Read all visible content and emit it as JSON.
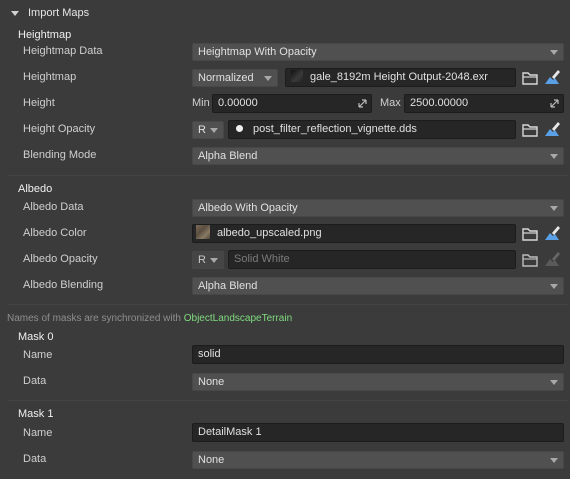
{
  "header": {
    "title": "Import Maps"
  },
  "heightmap": {
    "title": "Heightmap",
    "data_label": "Heightmap Data",
    "data_value": "Heightmap With Opacity",
    "heightmap_label": "Heightmap",
    "heightmap_mode": "Normalized",
    "heightmap_file": "gale_8192m Height Output-2048.exr",
    "height_label": "Height",
    "min_label": "Min",
    "min_value": "0.00000",
    "max_label": "Max",
    "max_value": "2500.00000",
    "opacity_label": "Height Opacity",
    "opacity_channel": "R",
    "opacity_file": "post_filter_reflection_vignette.dds",
    "blend_label": "Blending Mode",
    "blend_value": "Alpha Blend"
  },
  "albedo": {
    "title": "Albedo",
    "data_label": "Albedo Data",
    "data_value": "Albedo With Opacity",
    "color_label": "Albedo Color",
    "color_file": "albedo_upscaled.png",
    "opacity_label": "Albedo Opacity",
    "opacity_channel": "R",
    "opacity_placeholder": "Solid White",
    "blend_label": "Albedo Blending",
    "blend_value": "Alpha Blend"
  },
  "note": {
    "text": "Names of masks are synchronized with ",
    "link": "ObjectLandscapeTerrain"
  },
  "mask0": {
    "title": "Mask 0",
    "name_label": "Name",
    "name_value": "solid",
    "data_label": "Data",
    "data_value": "None"
  },
  "mask1": {
    "title": "Mask 1",
    "name_label": "Name",
    "name_value": "DetailMask 1",
    "data_label": "Data",
    "data_value": "None"
  },
  "colors": {
    "panel_bg": "#3b3b3b",
    "field_bg": "#262626",
    "dropdown_bg": "#505050",
    "link": "#7fdc7f"
  }
}
